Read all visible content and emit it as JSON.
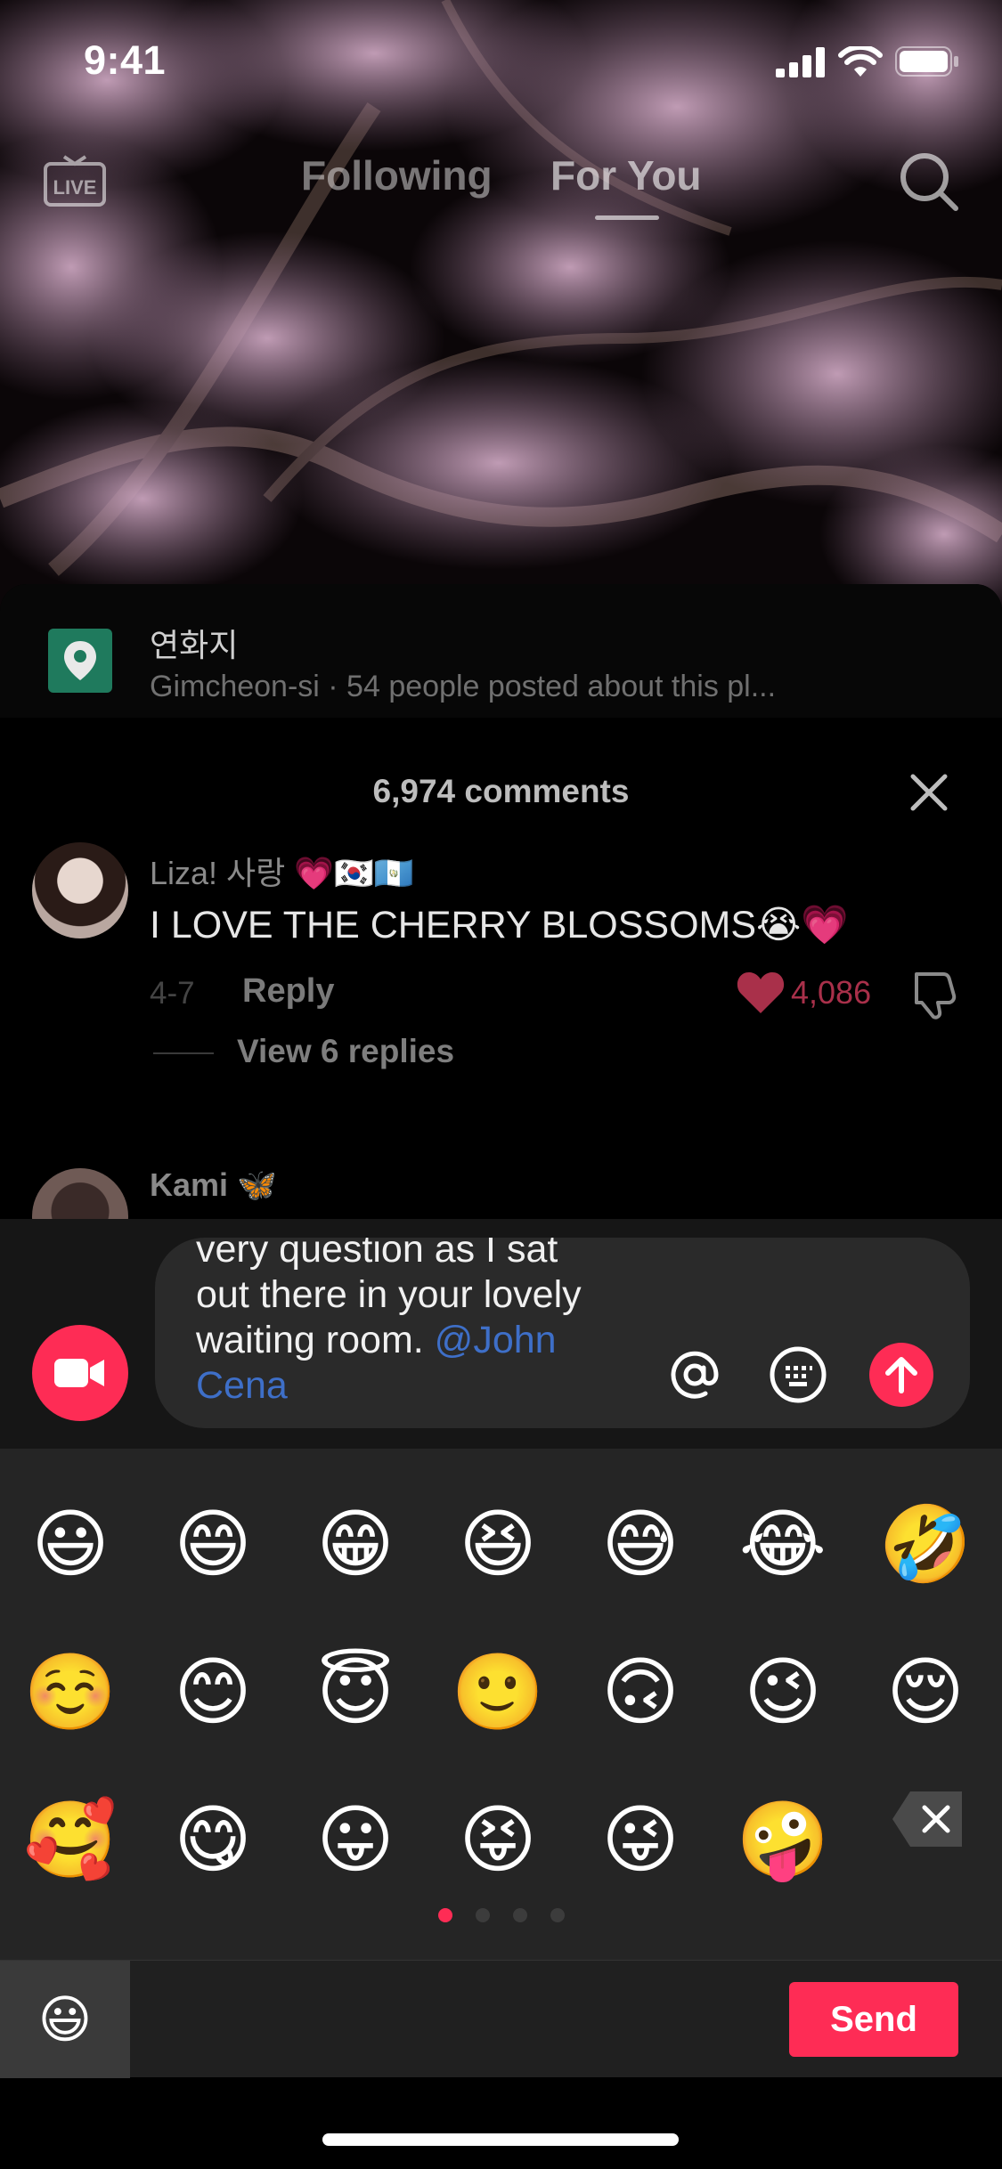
{
  "status_bar": {
    "time": "9:41"
  },
  "top_nav": {
    "tabs": [
      {
        "label": "Following"
      },
      {
        "label": "For You"
      }
    ]
  },
  "place": {
    "name": "연화지",
    "subtitle": "Gimcheon-si · 54 people posted about this pl..."
  },
  "comments": {
    "count_label": "6,974 comments",
    "items": [
      {
        "username": "Liza! 사랑 💗🇰🇷🇬🇹",
        "text": "I LOVE THE CHERRY BLOSSOMS😭💗",
        "date": "4-7",
        "reply_label": "Reply",
        "likes": "4,086",
        "view_replies": "View 6 replies"
      },
      {
        "username": "Kami 🦋"
      }
    ]
  },
  "compose": {
    "line1": "very question as I sat",
    "line2": "out there in your lovely",
    "line3": "waiting room. ",
    "mention": "@John",
    "mention2": "Cena"
  },
  "emoji_keyboard": {
    "rows": [
      [
        "😃",
        "😄",
        "😁",
        "😆",
        "😅",
        "😂",
        "🤣"
      ],
      [
        "☺️",
        "😊",
        "😇",
        "🙂",
        "🙃",
        "😉",
        "😌"
      ],
      [
        "🥰",
        "😋",
        "😛",
        "😝",
        "😜",
        "🤪"
      ]
    ],
    "active_page": 1,
    "page_count": 4,
    "footer_tab_emoji": "😃",
    "send_label": "Send"
  },
  "colors": {
    "accent": "#fe2c55",
    "mention": "#3e6fc8",
    "place_icon": "#1f7a5d"
  }
}
